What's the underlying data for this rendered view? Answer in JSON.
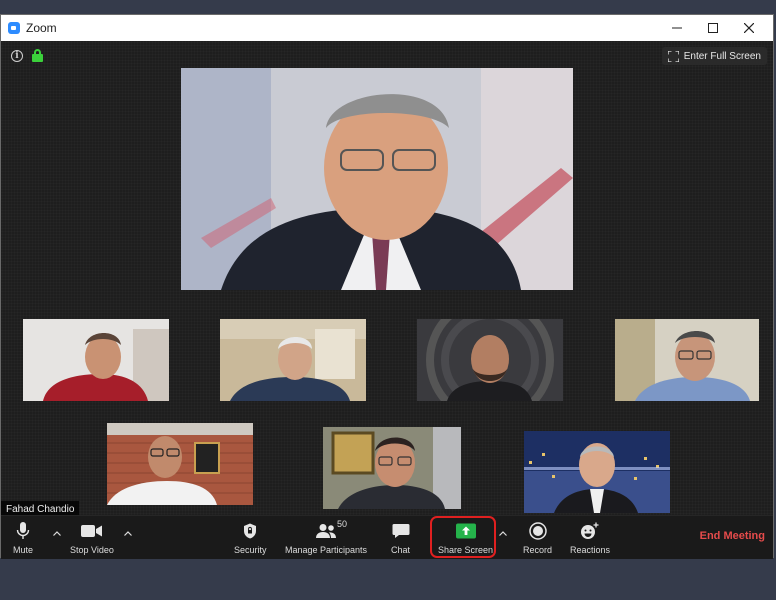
{
  "window": {
    "title": "Zoom",
    "controls": {
      "minimize": "—",
      "maximize": "☐",
      "close": "✕"
    }
  },
  "meeting_bar": {
    "info_icon": "info-icon",
    "lock_icon": "lock-icon",
    "fullscreen_label": "Enter Full Screen"
  },
  "active_speaker_name": "Fahad Chandio",
  "toolbar": {
    "mute_label": "Mute",
    "stop_video_label": "Stop Video",
    "security_label": "Security",
    "participants_label": "Manage Participants",
    "participants_count": "50",
    "chat_label": "Chat",
    "share_label": "Share Screen",
    "record_label": "Record",
    "reactions_label": "Reactions",
    "end_label": "End Meeting"
  },
  "colors": {
    "accent_green": "#3bd13b",
    "share_green": "#25b34b",
    "highlight_red": "#e02020",
    "end_red": "#e54b4b"
  }
}
